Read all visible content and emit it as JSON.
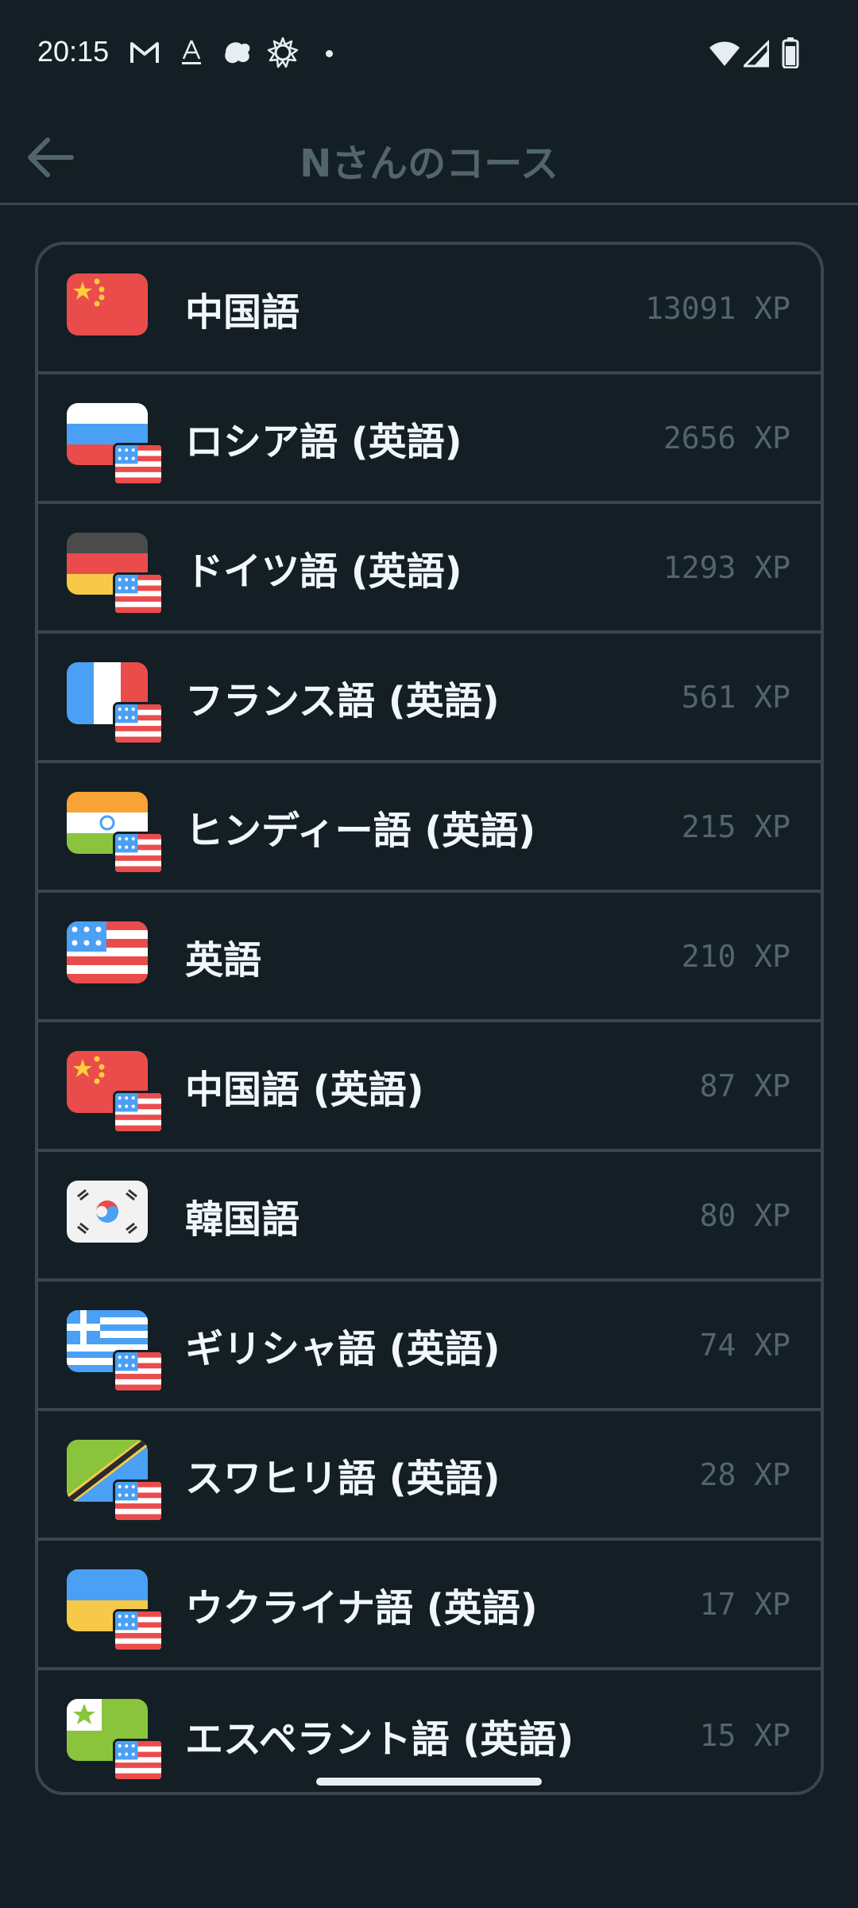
{
  "status_bar": {
    "time": "20:15"
  },
  "header": {
    "title": "Nさんのコース"
  },
  "courses": [
    {
      "name": "中国語",
      "xp": "13091 XP",
      "flag": "china",
      "base": ""
    },
    {
      "name": "ロシア語 (英語)",
      "xp": "2656 XP",
      "flag": "russia",
      "base": "usa"
    },
    {
      "name": "ドイツ語 (英語)",
      "xp": "1293 XP",
      "flag": "germany",
      "base": "usa"
    },
    {
      "name": "フランス語 (英語)",
      "xp": "561 XP",
      "flag": "france",
      "base": "usa"
    },
    {
      "name": "ヒンディー語 (英語)",
      "xp": "215 XP",
      "flag": "india",
      "base": "usa"
    },
    {
      "name": "英語",
      "xp": "210 XP",
      "flag": "usa",
      "base": ""
    },
    {
      "name": "中国語 (英語)",
      "xp": "87 XP",
      "flag": "china",
      "base": "usa"
    },
    {
      "name": "韓国語",
      "xp": "80 XP",
      "flag": "korea",
      "base": ""
    },
    {
      "name": "ギリシャ語 (英語)",
      "xp": "74 XP",
      "flag": "greece",
      "base": "usa"
    },
    {
      "name": "スワヒリ語 (英語)",
      "xp": "28 XP",
      "flag": "tanzania",
      "base": "usa"
    },
    {
      "name": "ウクライナ語 (英語)",
      "xp": "17 XP",
      "flag": "ukraine",
      "base": "usa"
    },
    {
      "name": "エスペラント語 (英語)",
      "xp": "15 XP",
      "flag": "esperanto",
      "base": "usa"
    }
  ],
  "colors": {
    "background": "#131f24",
    "border": "#37464f",
    "muted_text": "#52656d",
    "primary_text": "#f1f7fb"
  }
}
